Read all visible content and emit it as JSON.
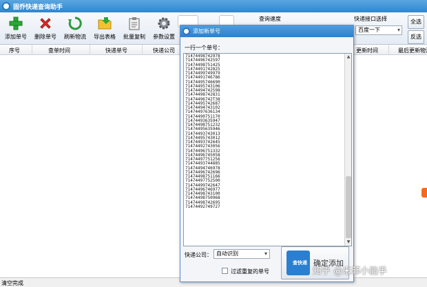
{
  "window": {
    "title": "固乔快递查询助手"
  },
  "toolbar": {
    "buttons": [
      {
        "label": "添加单号",
        "icon": "plus-icon"
      },
      {
        "label": "删除单号",
        "icon": "delete-x-icon"
      },
      {
        "label": "刷新物流",
        "icon": "refresh-icon"
      },
      {
        "label": "导出表格",
        "icon": "export-folder-icon"
      },
      {
        "label": "批量复制",
        "icon": "clipboard-icon"
      },
      {
        "label": "参数设置",
        "icon": "gear-icon"
      }
    ],
    "query_speed_label": "查询速度",
    "api_label": "快递接口选择",
    "api_value": "百度一下",
    "select_all_label": "全选",
    "invert_select_label": "反选"
  },
  "table": {
    "headers": [
      "序号",
      "查单时间",
      "快递单号",
      "快递公司",
      "更新时间",
      "最后更新物流"
    ]
  },
  "status": {
    "text": "清空完成"
  },
  "dialog": {
    "title": "添加新单号",
    "hint": "一行一个单号：",
    "tracking_numbers": [
      "71474498742978",
      "71474496742597",
      "71474498751425",
      "71474491742825",
      "71474499749979",
      "71474491746786",
      "71474495746690",
      "71474495743106",
      "71474494742598",
      "71474498742831",
      "71474496742T38",
      "71474495742687",
      "71474494743102",
      "71474497636134",
      "71474490751170",
      "71474493635947",
      "71474498751232",
      "71474495635946",
      "71474493743013",
      "71474495743012",
      "71474493742645",
      "71474492743056",
      "71474496751332",
      "71474496745058",
      "71474497751256",
      "71474493744885",
      "71474494746978",
      "71474496742696",
      "71474498751166",
      "71474497752500",
      "71474499742647",
      "71474496746977",
      "71474498743100",
      "71474498750968",
      "71474498742695",
      "71474492749727"
    ],
    "courier_label": "快递公司：",
    "courier_value": "自动识别",
    "filter_dup_label": "过滤重复的单号",
    "confirm_label": "确定添加",
    "logo_text": "查快递"
  },
  "watermark": {
    "text": "知乎 @米菲小能手"
  },
  "colors": {
    "titlebar": "#2f86cf",
    "dialog_title": "#2f80c9",
    "accent": "#2a7fd0",
    "badge": "#f26b21"
  }
}
